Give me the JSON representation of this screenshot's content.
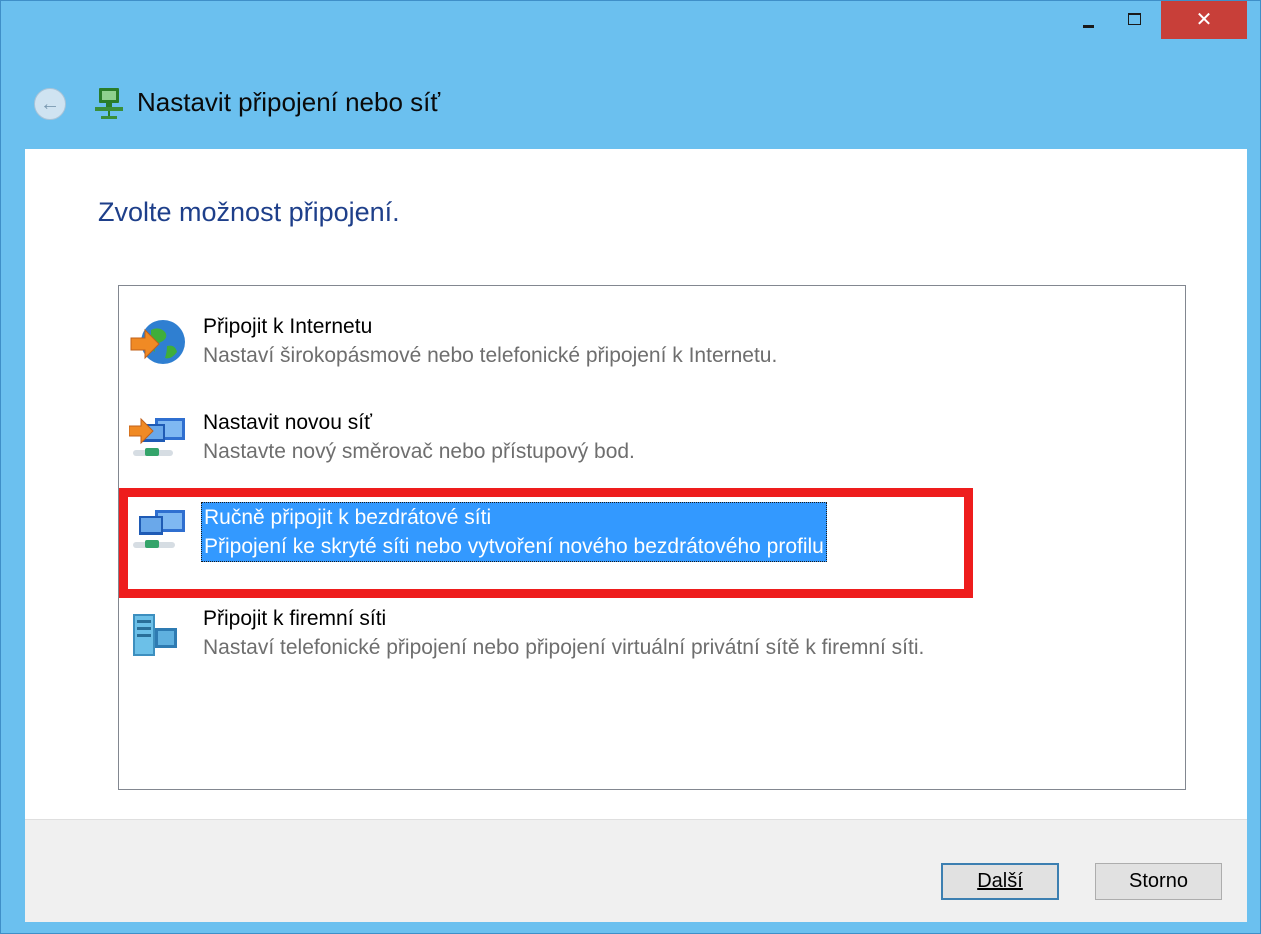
{
  "window": {
    "title": "Nastavit připojení nebo síť",
    "accent": "#6bc0ef",
    "close_color": "#c83f39"
  },
  "titlebar": {
    "minimize_icon": "minimize-icon",
    "maximize_icon": "maximize-icon",
    "close_glyph": "✕"
  },
  "header": {
    "back_glyph": "←"
  },
  "main": {
    "heading": "Zvolte možnost připojení.",
    "options": [
      {
        "label": "Připojit k Internetu",
        "description": "Nastaví širokopásmové nebo telefonické připojení k Internetu.",
        "icon": "internet-globe-icon"
      },
      {
        "label": "Nastavit novou síť",
        "description": "Nastavte nový směrovač nebo přístupový bod.",
        "icon": "new-network-icon"
      },
      {
        "label": "Ručně připojit k bezdrátové síti",
        "description": "Připojení ke skryté síti nebo vytvoření nového bezdrátového profilu",
        "icon": "wireless-network-icon",
        "selected": true
      },
      {
        "label": "Připojit k firemní síti",
        "description": "Nastaví telefonické připojení nebo připojení virtuální privátní sítě k firemní síti.",
        "icon": "workplace-network-icon"
      }
    ],
    "highlight_color": "#ee1d1d",
    "selection_color": "#3399ff"
  },
  "footer": {
    "next_label": "Další",
    "cancel_label": "Storno"
  }
}
